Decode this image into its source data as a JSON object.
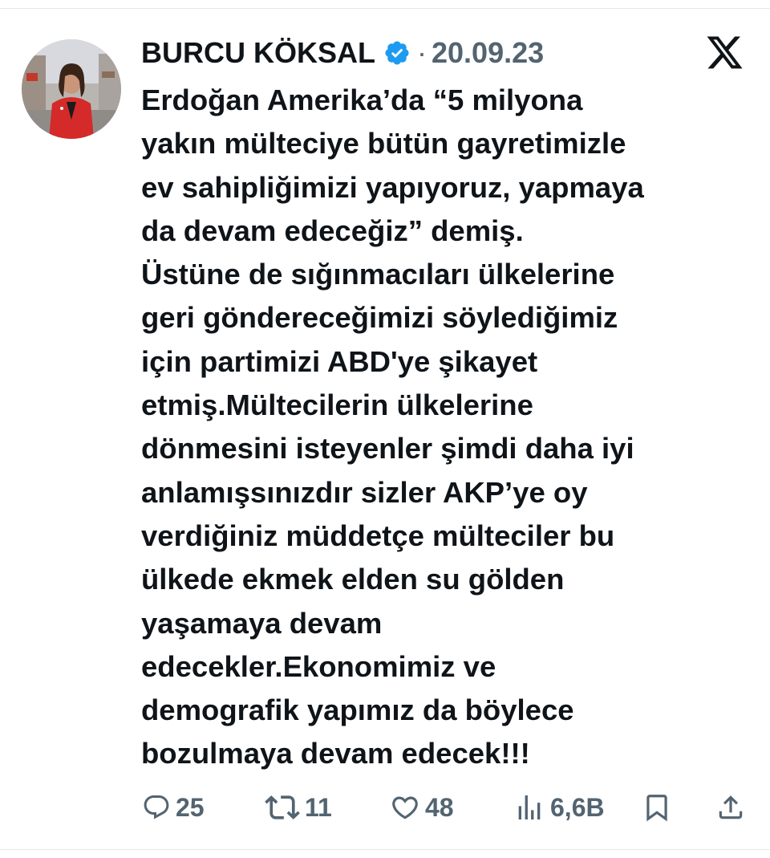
{
  "author": {
    "display_name": "BURCU KÖKSAL",
    "separator": "·",
    "date": "20.09.23",
    "verified_icon": "verified-badge-icon"
  },
  "platform_logo": "x-logo-icon",
  "tweet": {
    "lines": [
      "Erdoğan Amerika’da “5 milyona",
      "yakın mülteciye bütün gayretimizle",
      "ev sahipliğimizi yapıyoruz, yapmaya",
      "da devam edeceğiz” demiş.",
      "Üstüne de sığınmacıları ülkelerine",
      "geri göndereceğimizi söylediğimiz",
      "için partimizi ABD'ye şikayet",
      "etmiş.Mültecilerin ülkelerine",
      "dönmesini isteyenler şimdi daha iyi",
      "anlamışsınızdır sizler AKP’ye oy",
      "verdiğiniz müddetçe mülteciler bu",
      "ülkede ekmek elden su gölden",
      "yaşamaya devam",
      "edecekler.Ekonomimiz ve",
      "demografik yapımız da böylece",
      "bozulmaya devam edecek!!!"
    ]
  },
  "actions": {
    "replies": "25",
    "reposts": "11",
    "likes": "48",
    "views": "6,6B"
  },
  "colors": {
    "text": "#0f1419",
    "secondary": "#536471",
    "verified": "#1d9bf0",
    "divider": "#e7e9ea"
  }
}
